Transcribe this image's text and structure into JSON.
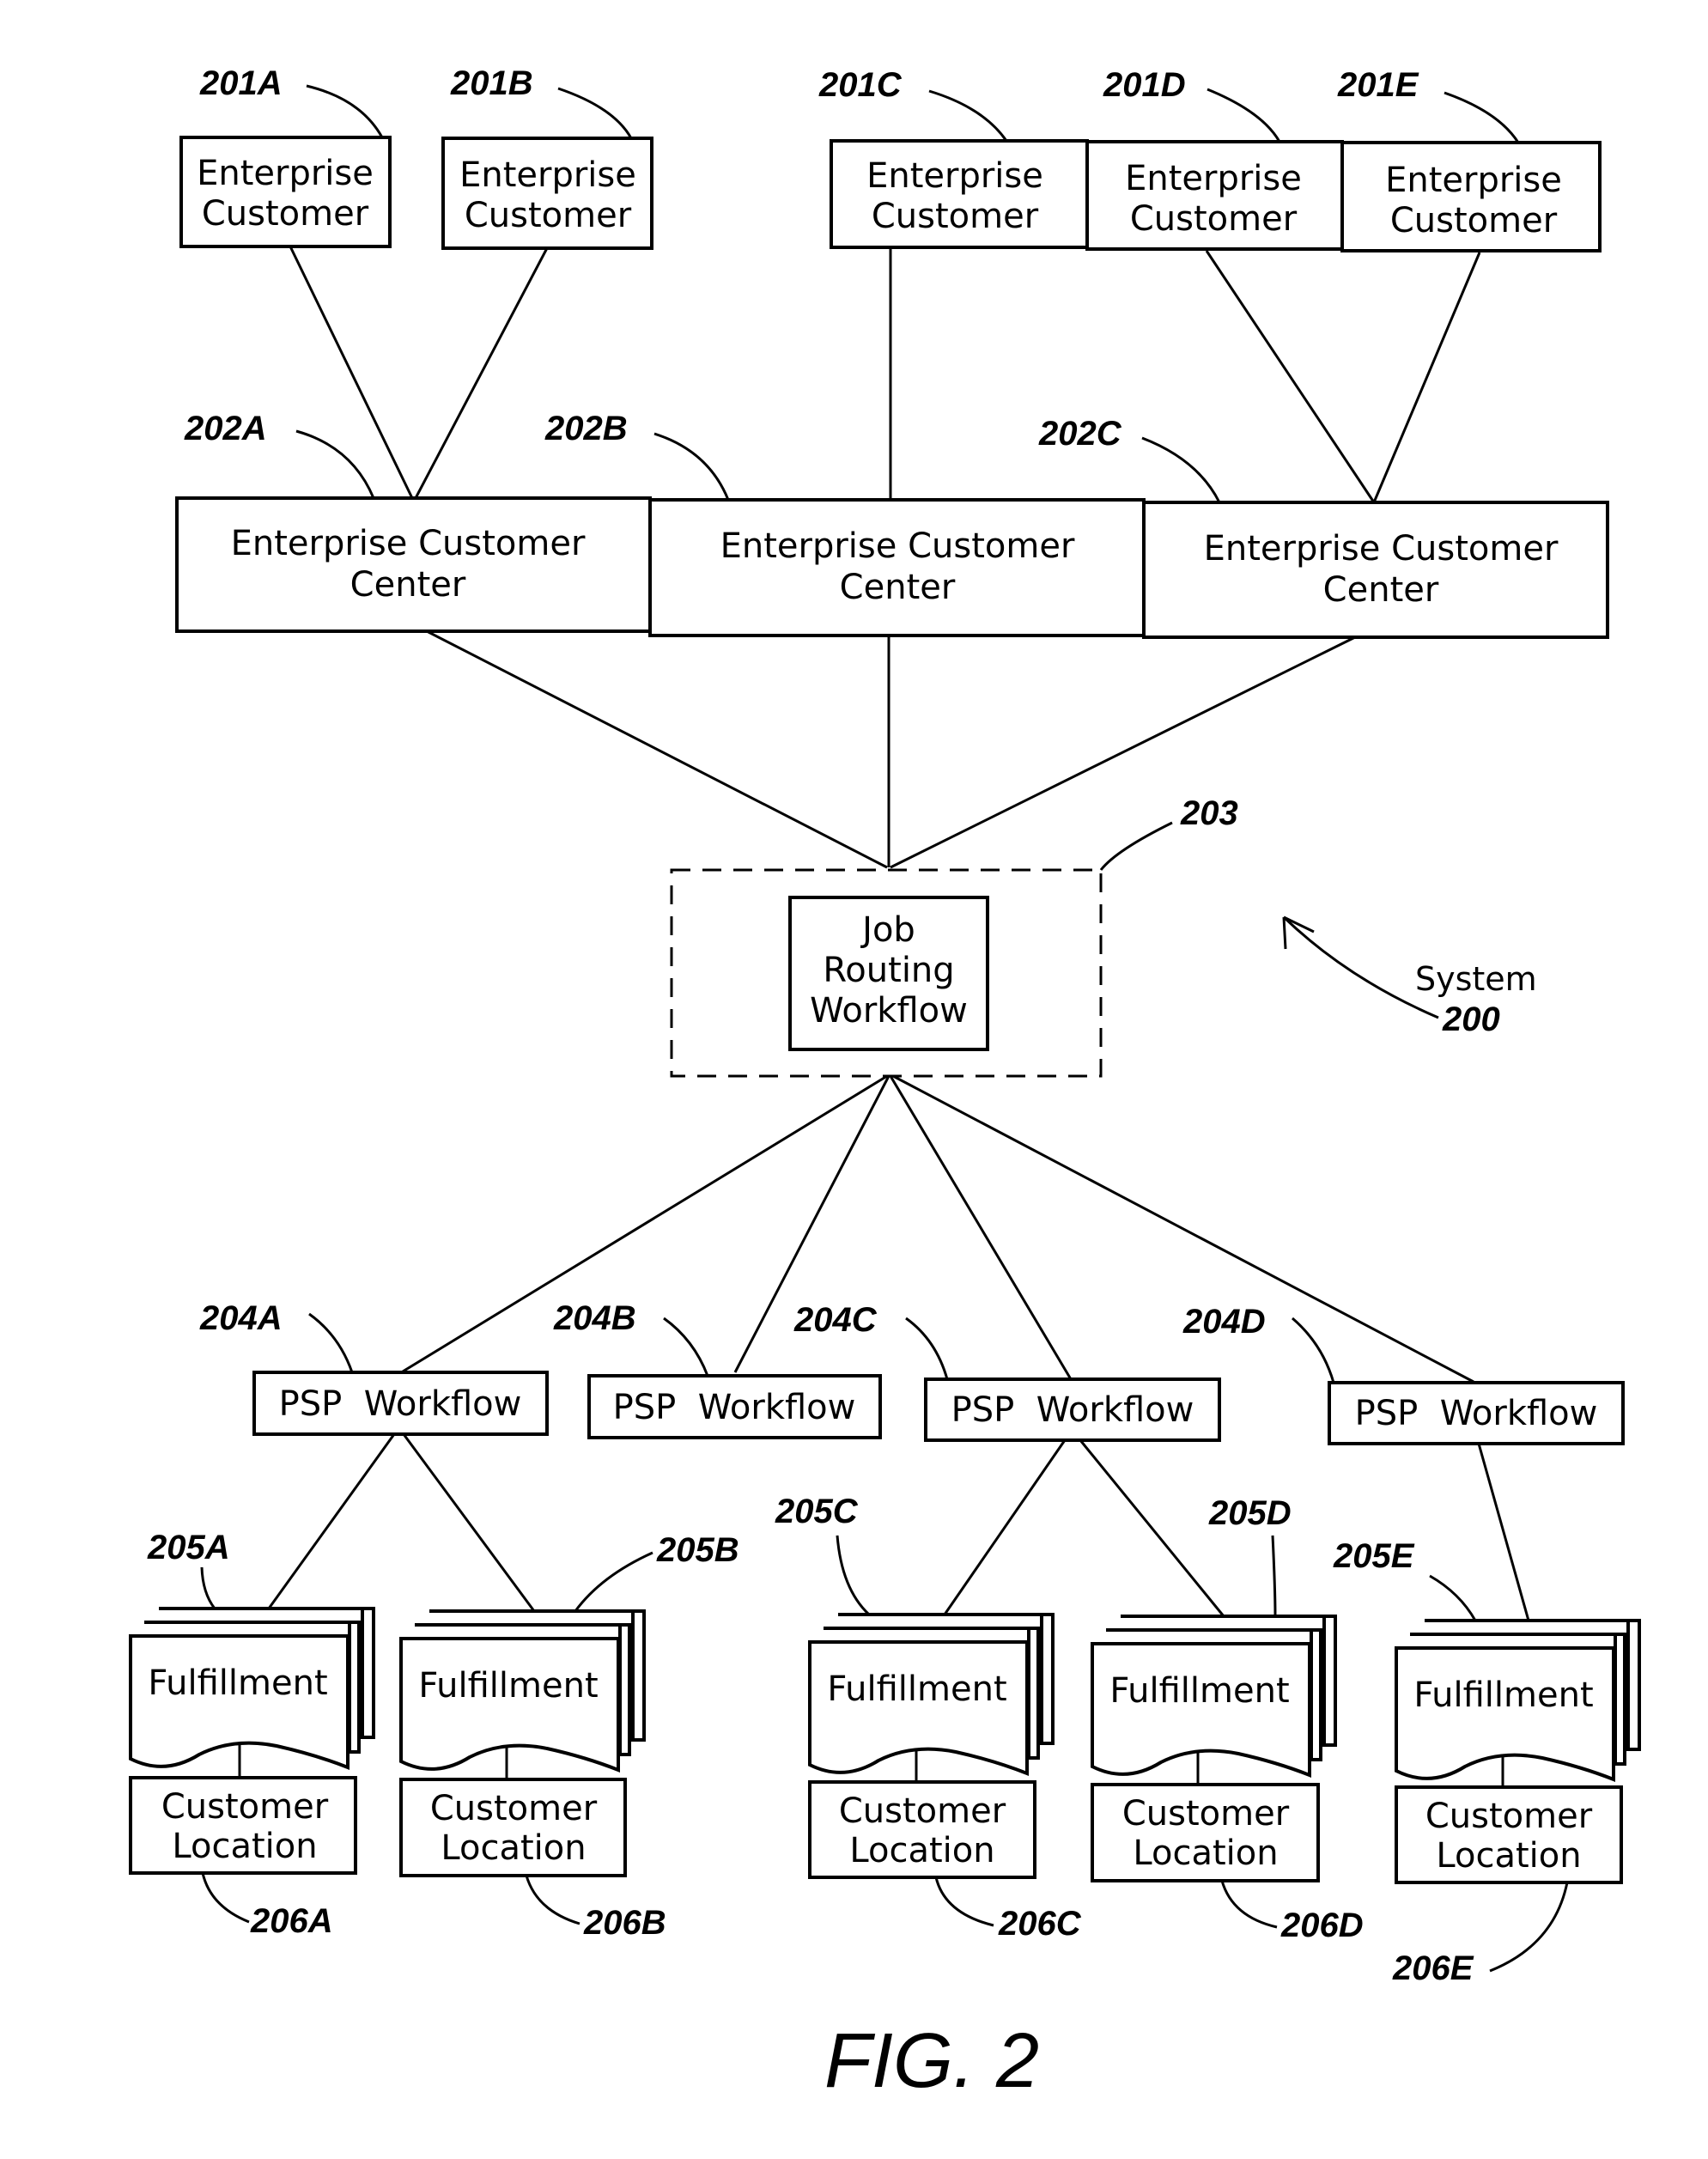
{
  "figure": {
    "title": "FIG. 2",
    "system_label": "System",
    "system_ref": "200"
  },
  "enterprise_customers": [
    {
      "ref": "201A",
      "line1": "Enterprise",
      "line2": "Customer"
    },
    {
      "ref": "201B",
      "line1": "Enterprise",
      "line2": "Customer"
    },
    {
      "ref": "201C",
      "line1": "Enterprise",
      "line2": "Customer"
    },
    {
      "ref": "201D",
      "line1": "Enterprise",
      "line2": "Customer"
    },
    {
      "ref": "201E",
      "line1": "Enterprise",
      "line2": "Customer"
    }
  ],
  "customer_centers": [
    {
      "ref": "202A",
      "line1": "Enterprise Customer",
      "line2": "Center"
    },
    {
      "ref": "202B",
      "line1": "Enterprise Customer",
      "line2": "Center"
    },
    {
      "ref": "202C",
      "line1": "Enterprise Customer",
      "line2": "Center"
    }
  ],
  "job_routing": {
    "ref": "203",
    "line1": "Job",
    "line2": "Routing",
    "line3": "Workflow"
  },
  "psp_workflows": [
    {
      "ref": "204A",
      "label": "PSP  Workflow"
    },
    {
      "ref": "204B",
      "label": "PSP  Workflow"
    },
    {
      "ref": "204C",
      "label": "PSP  Workflow"
    },
    {
      "ref": "204D",
      "label": "PSP  Workflow"
    }
  ],
  "fulfillments": [
    {
      "ref": "205A",
      "label": "Fulfillment"
    },
    {
      "ref": "205B",
      "label": "Fulfillment"
    },
    {
      "ref": "205C",
      "label": "Fulfillment"
    },
    {
      "ref": "205D",
      "label": "Fulfillment"
    },
    {
      "ref": "205E",
      "label": "Fulfillment"
    }
  ],
  "customer_locations": [
    {
      "ref": "206A",
      "line1": "Customer",
      "line2": "Location"
    },
    {
      "ref": "206B",
      "line1": "Customer",
      "line2": "Location"
    },
    {
      "ref": "206C",
      "line1": "Customer",
      "line2": "Location"
    },
    {
      "ref": "206D",
      "line1": "Customer",
      "line2": "Location"
    },
    {
      "ref": "206E",
      "line1": "Customer",
      "line2": "Location"
    }
  ]
}
